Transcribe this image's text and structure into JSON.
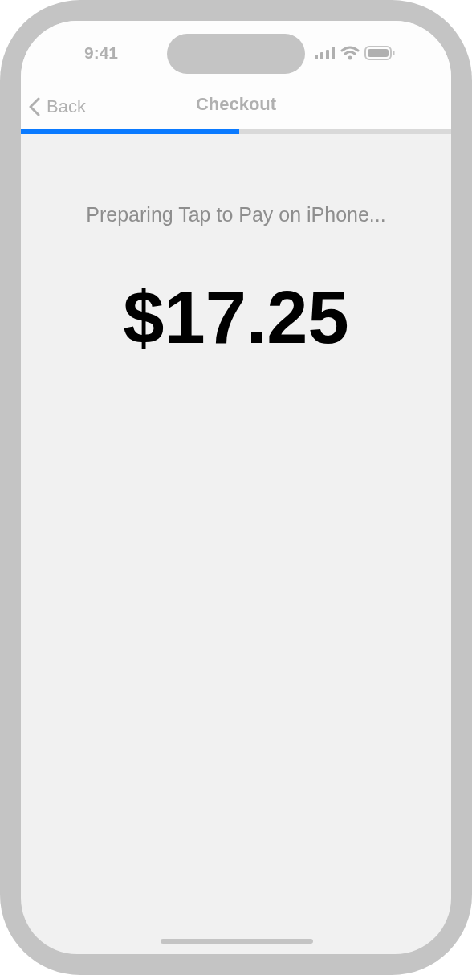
{
  "status_bar": {
    "time": "9:41"
  },
  "nav": {
    "back_label": "Back",
    "back_disabled": true,
    "title": "Checkout"
  },
  "progress": {
    "level": 0.507
  },
  "message": "Preparing Tap to Pay on iPhone...",
  "amount": "$17.25"
}
